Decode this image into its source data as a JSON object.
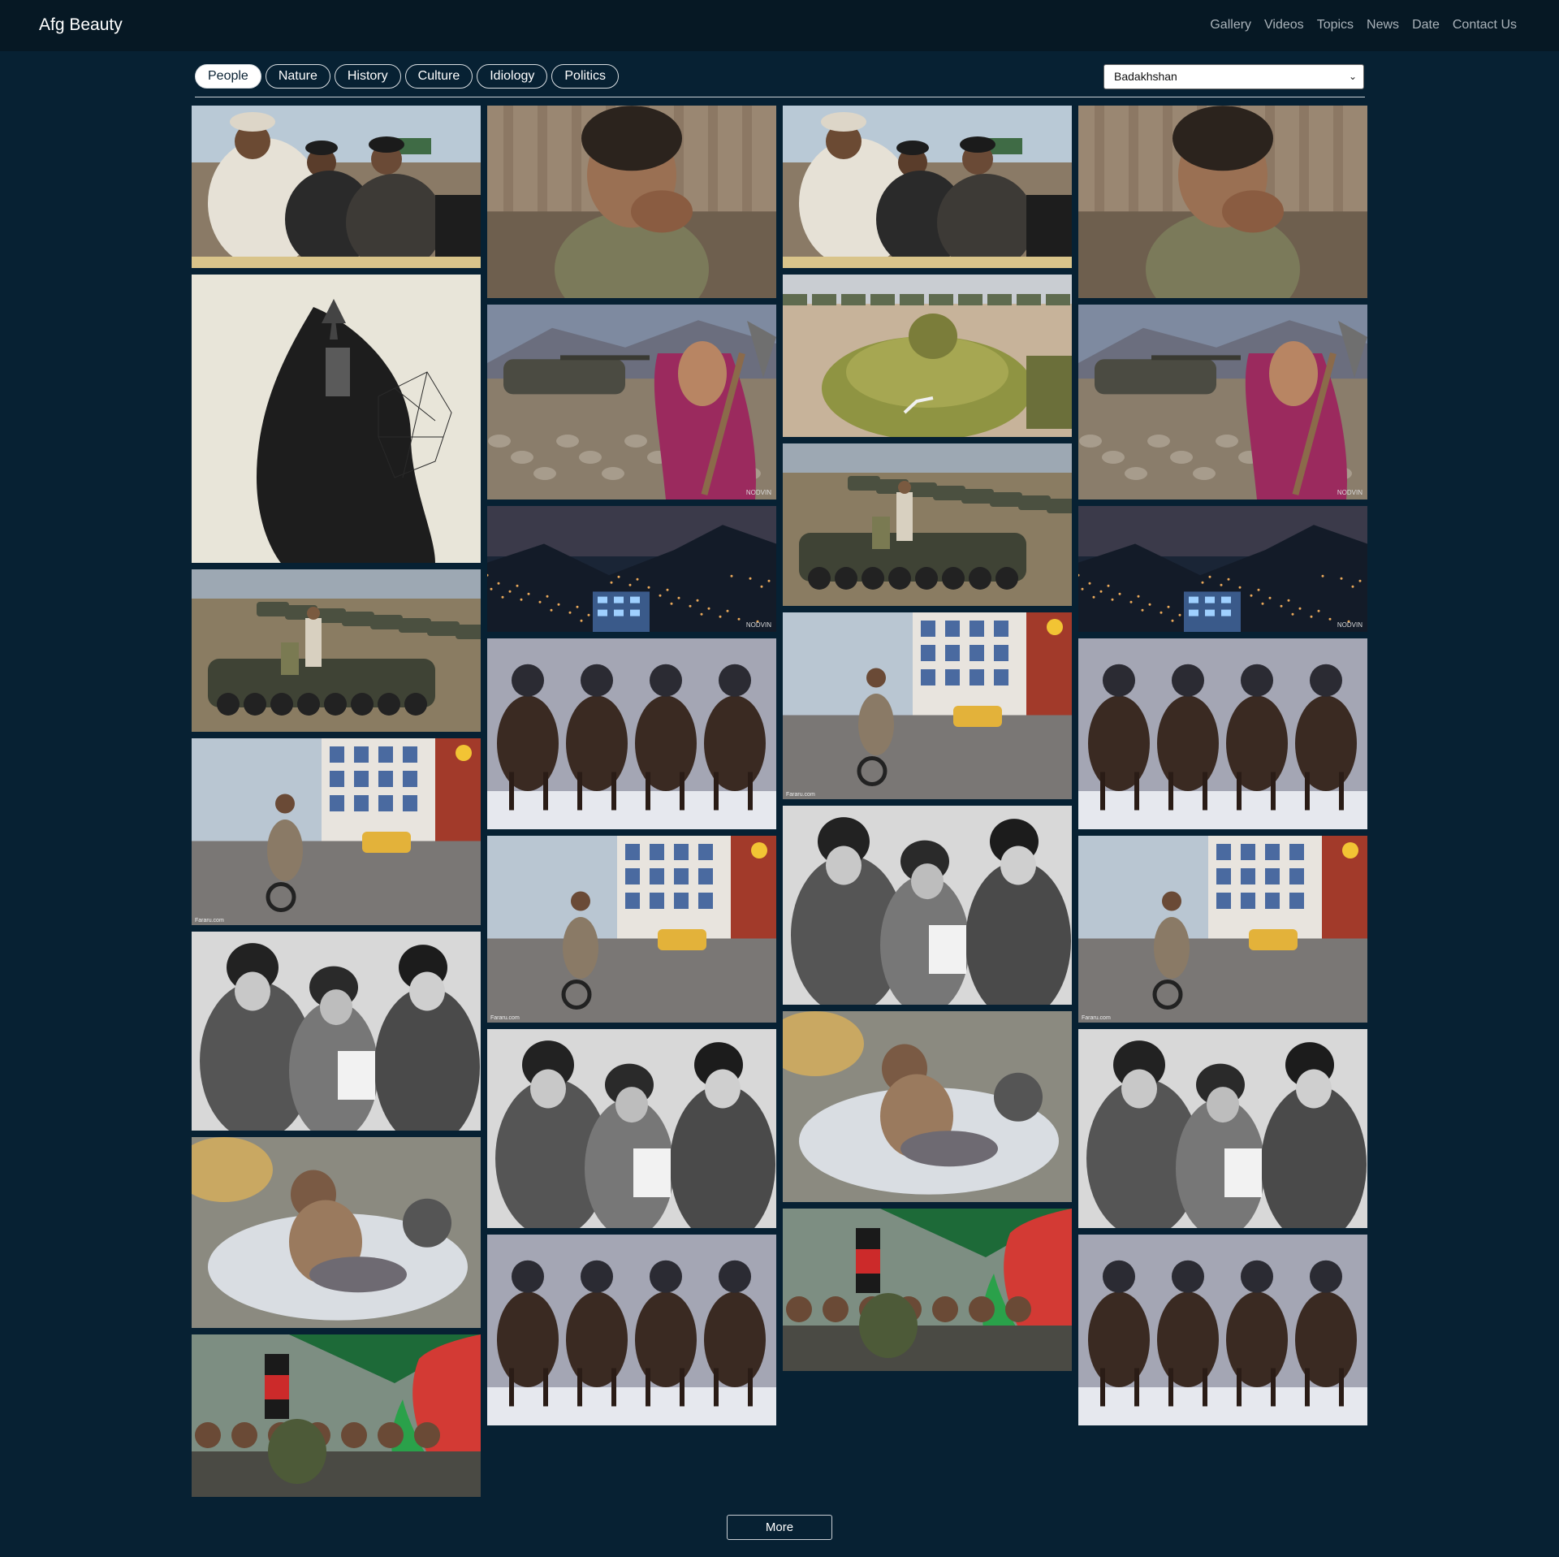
{
  "brand": "Afg Beauty",
  "nav": [
    "Gallery",
    "Videos",
    "Topics",
    "News",
    "Date",
    "Contact Us"
  ],
  "filters": [
    "People",
    "Nature",
    "History",
    "Culture",
    "Idiology",
    "Politics"
  ],
  "active_filter": "People",
  "province_select": {
    "value": "Badakhshan"
  },
  "more_button": "More",
  "photo_kinds": {
    "militia": "militia-group-photo",
    "boy": "boy-portrait-photo",
    "sketch": "double-exposure-woman-photo",
    "girl": "girl-with-tank-photo",
    "wreck": "tank-wreck-photo",
    "tanks": "tank-graveyard-photo",
    "city": "city-night-photo",
    "horses": "buzkashi-horsemen-photo",
    "street": "motorcycle-street-photo",
    "bw": "students-bw-photo",
    "kids": "children-resting-photo",
    "flags": "flag-celebration-photo"
  },
  "watermarks": {
    "nodvin": "NODVIN",
    "fararu": "Fararu.com"
  }
}
